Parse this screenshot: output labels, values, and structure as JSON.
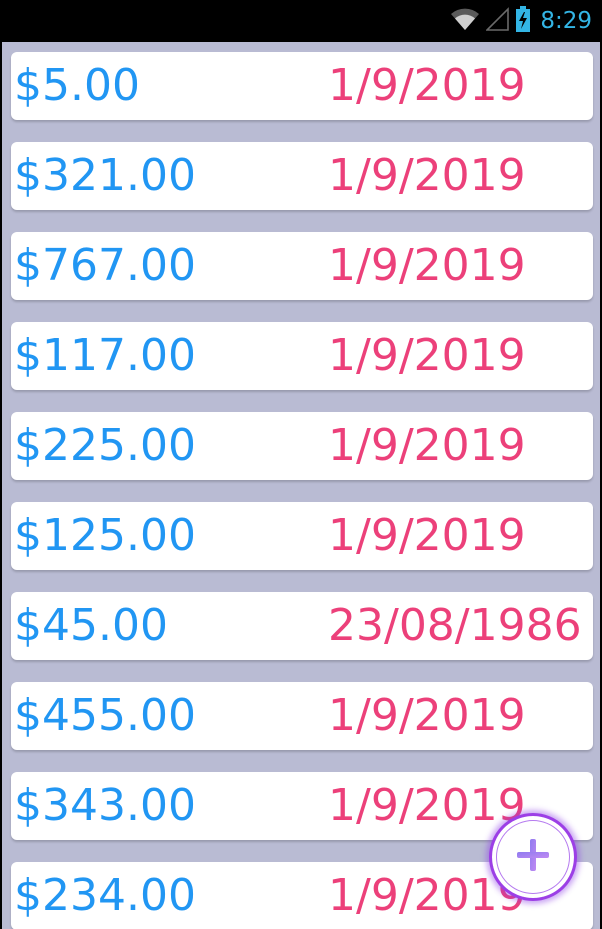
{
  "status_bar": {
    "time": "8:29",
    "icons": [
      "wifi-icon",
      "signal-icon",
      "battery-charging-icon"
    ]
  },
  "entries": [
    {
      "amount": "$5.00",
      "date": "1/9/2019"
    },
    {
      "amount": "$321.00",
      "date": "1/9/2019"
    },
    {
      "amount": "$767.00",
      "date": "1/9/2019"
    },
    {
      "amount": "$117.00",
      "date": "1/9/2019"
    },
    {
      "amount": "$225.00",
      "date": "1/9/2019"
    },
    {
      "amount": "$125.00",
      "date": "1/9/2019"
    },
    {
      "amount": "$45.00",
      "date": "23/08/1986"
    },
    {
      "amount": "$455.00",
      "date": "1/9/2019"
    },
    {
      "amount": "$343.00",
      "date": "1/9/2019"
    },
    {
      "amount": "$234.00",
      "date": "1/9/2019"
    }
  ],
  "fab": {
    "icon": "plus-icon"
  },
  "colors": {
    "amount": "#2196f3",
    "date": "#ec407a",
    "background": "#b9bbd3",
    "fab_ring": "#9c3fe6",
    "status_accent": "#33b5e5"
  }
}
